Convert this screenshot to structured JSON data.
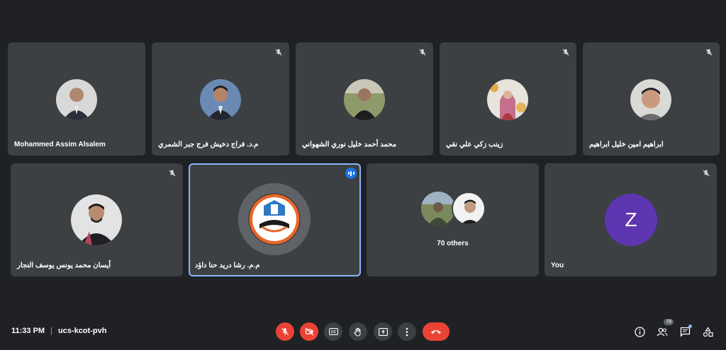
{
  "participants": [
    {
      "name": "Mohammed Assim Alsalem",
      "muted": false
    },
    {
      "name": "م.د. فراج دخيش فرج جبر الشمري",
      "muted": true
    },
    {
      "name": "محمد أحمد خليل نوري الشهواني",
      "muted": true
    },
    {
      "name": "زينب زكي علي نقي",
      "muted": true
    },
    {
      "name": "ابراهيم امين خليل ابراهيم",
      "muted": true
    },
    {
      "name": "أيسان محمد يونس يوسف النجار",
      "muted": true
    },
    {
      "name": "م.م. رشا دريد حنا داؤد",
      "muted": false,
      "speaking": true
    },
    {
      "name": "",
      "muted": false
    },
    {
      "name": "You",
      "muted": true
    }
  ],
  "others_tile": {
    "label": "70 others"
  },
  "self_avatar_letter": "Z",
  "footer": {
    "time": "11:33 PM",
    "separator": "|",
    "meeting_code": "ucs-kcot-pvh",
    "people_count": "78"
  },
  "icons": {
    "mic": "mic-off-icon",
    "camera": "camera-off-icon",
    "captions": "closed-captions-icon",
    "hand": "raise-hand-icon",
    "present": "present-screen-icon",
    "more": "more-options-icon",
    "end": "end-call-icon",
    "info": "meeting-info-icon",
    "people": "people-icon",
    "chat": "chat-icon",
    "activities": "activities-icon"
  },
  "colors": {
    "background": "#202124",
    "tile": "#3c4043",
    "danger": "#ea4335",
    "accent": "#8ab4f8",
    "avatar_purple": "#5e35b1"
  }
}
